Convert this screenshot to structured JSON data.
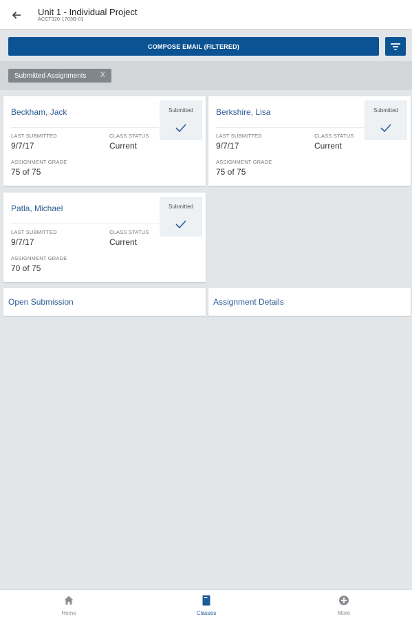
{
  "header": {
    "title": "Unit 1 - Individual Project",
    "subtitle": "ACCT320-1703B-01"
  },
  "actions": {
    "compose_label": "COMPOSE EMAIL (FILTERED)"
  },
  "filter_chip": {
    "label": "Submitted Assignments",
    "close_glyph": "X"
  },
  "labels": {
    "last_submitted": "LAST SUBMITTED",
    "class_status": "CLASS STATUS",
    "assignment_grade": "ASSIGNMENT GRADE"
  },
  "students": [
    {
      "name": "Beckham, Jack",
      "badge": "Submitted",
      "last_submitted": "9/7/17",
      "class_status": "Current",
      "grade": "75 of 75"
    },
    {
      "name": "Berkshire, Lisa",
      "badge": "Submitted",
      "last_submitted": "9/7/17",
      "class_status": "Current",
      "grade": "75 of 75"
    },
    {
      "name": "Patla, Michael",
      "badge": "Submitted",
      "last_submitted": "9/7/17",
      "class_status": "Current",
      "grade": "70 of 75"
    }
  ],
  "links": {
    "open_submission": "Open Submission",
    "assignment_details": "Assignment Details"
  },
  "bottom_nav": [
    {
      "label": "Home",
      "icon": "home-icon",
      "active": false
    },
    {
      "label": "Classes",
      "icon": "book-icon",
      "active": true
    },
    {
      "label": "More",
      "icon": "plus-circle-icon",
      "active": false
    }
  ],
  "colors": {
    "primary": "#0c5394",
    "link": "#2e5c96",
    "chip": "#7f868c",
    "background": "#e3e6e8"
  }
}
